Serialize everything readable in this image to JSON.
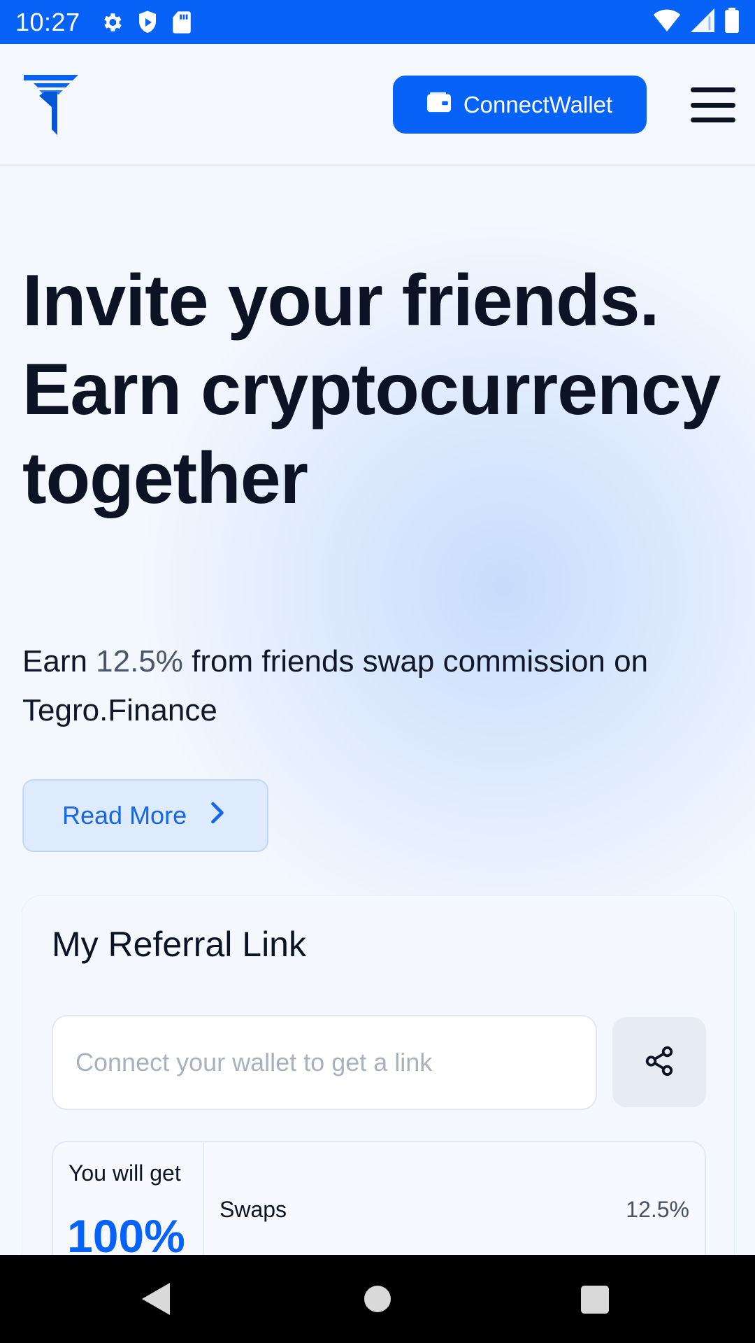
{
  "status_bar": {
    "time": "10:27",
    "icons_left": [
      "gear-icon",
      "shield-play-icon",
      "sd-card-icon"
    ],
    "icons_right": [
      "wifi-icon",
      "signal-icon",
      "battery-icon"
    ]
  },
  "header": {
    "logo": "tegro-logo-icon",
    "connect_wallet_label": "ConnectWallet",
    "menu_icon": "hamburger-menu-icon"
  },
  "hero": {
    "title": "Invite your friends. Earn cryptocurrency together",
    "subtitle_prefix": "Earn ",
    "subtitle_percent": "12.5%",
    "subtitle_suffix": " from friends swap commission on Tegro.Finance",
    "read_more_label": "Read More"
  },
  "referral": {
    "title": "My Referral Link",
    "input_placeholder": "Connect your wallet to get a link",
    "input_value": "",
    "you_will_get_label": "You will get",
    "you_will_get_value": "100%",
    "rows": [
      {
        "name": "Swaps",
        "value": "12.5%"
      }
    ]
  },
  "colors": {
    "accent": "#0763f7",
    "text_dark": "#0b1324",
    "background": "#f3f7fe"
  }
}
